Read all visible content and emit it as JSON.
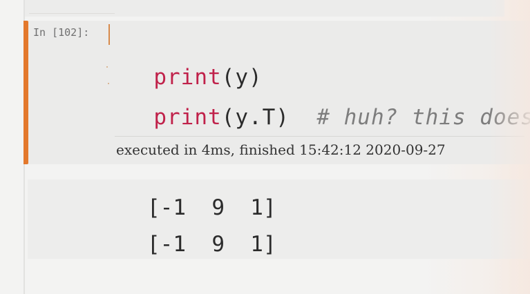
{
  "cell": {
    "prompt": "In [102]:",
    "code": {
      "line1": {
        "func": "print",
        "args": "(y)"
      },
      "line2": {
        "func": "print",
        "args": "(y.T)",
        "comment": "# huh? this does"
      }
    },
    "exec_info": "executed in 4ms, finished 15:42:12 2020-09-27"
  },
  "output": {
    "lines": [
      "[-1  9  1]",
      "[-1  9  1]"
    ]
  },
  "colors": {
    "accent": "#e3782c",
    "keyword": "#c0214a",
    "comment": "#7d7d7d"
  }
}
